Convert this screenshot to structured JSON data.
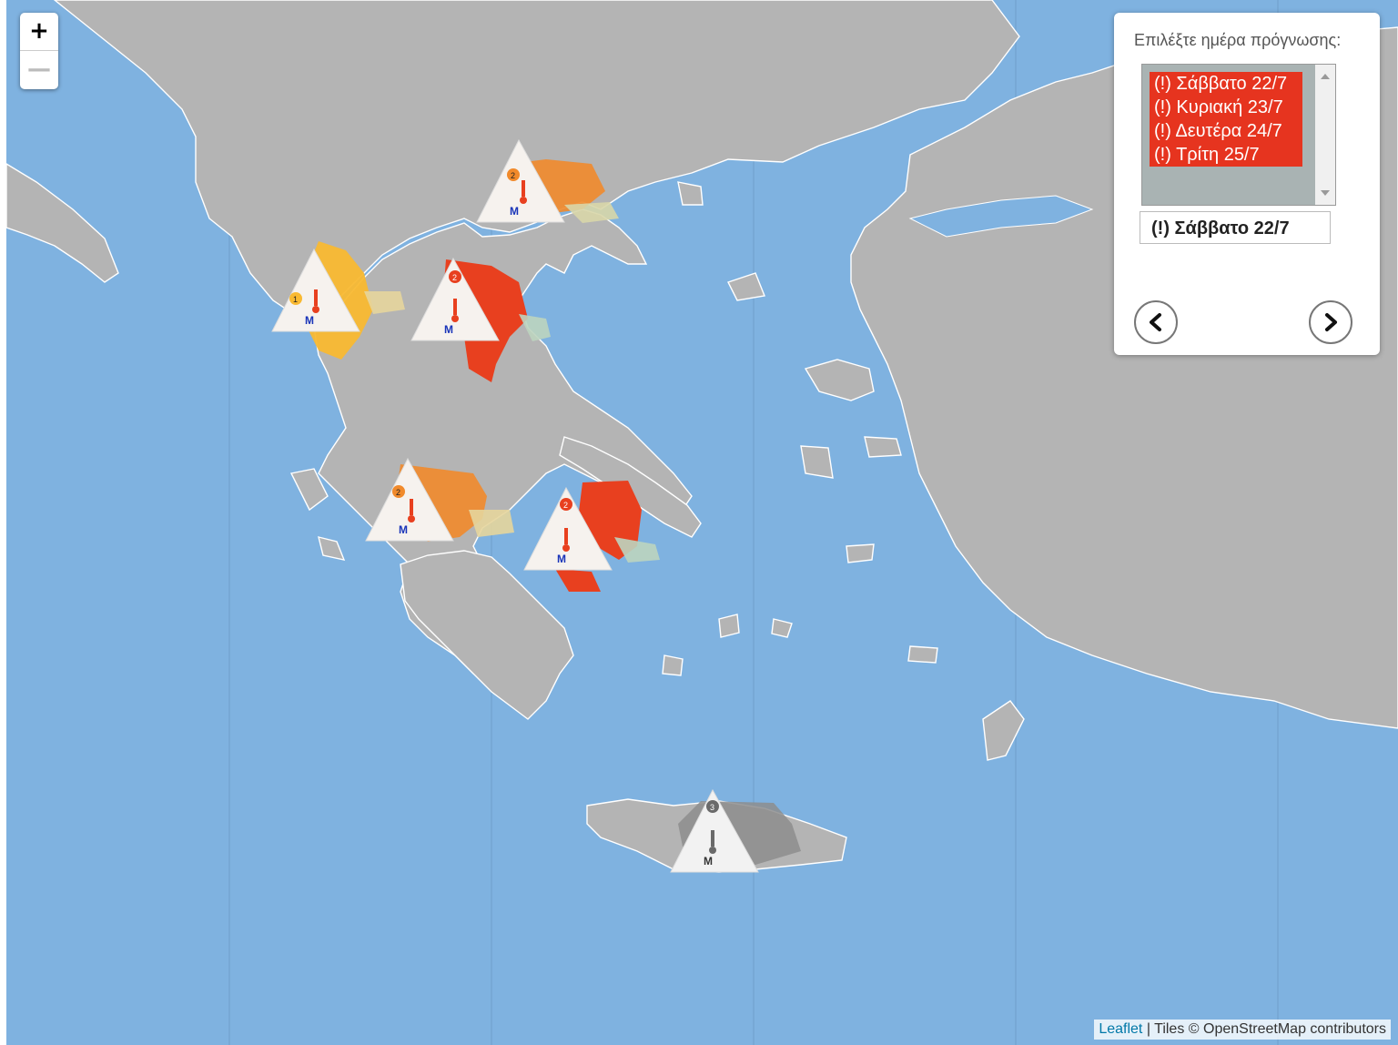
{
  "map": {
    "zoom": {
      "in_label": "+",
      "out_label": "—"
    },
    "attribution": {
      "leaflet": "Leaflet",
      "separator": " | ",
      "tiles": "Tiles © OpenStreetMap contributors"
    },
    "colors": {
      "sea": "#7fb2e0",
      "land": "#b3b3b3",
      "border": "#ffffff",
      "level2": "#e8401f",
      "level1": "#f9b931",
      "level1_orange": "#f18a2b",
      "grey": "#8d8d8d"
    }
  },
  "forecast_panel": {
    "label": "Επιλέξτε ημέρα πρόγνωσης:",
    "options": [
      "(!) Σάββατο 22/7",
      "(!) Κυριακή 23/7",
      "(!) Δευτέρα 24/7",
      "(!) Τρίτη 25/7"
    ],
    "selected": "(!) Σάββατο 22/7",
    "prev_icon": "chevron-left-icon",
    "next_icon": "chevron-right-icon"
  },
  "warning_markers": [
    {
      "region": "central-macedonia",
      "level": "2",
      "color": "orange"
    },
    {
      "region": "epirus",
      "level": "1",
      "color": "yellow"
    },
    {
      "region": "thessaly",
      "level": "2",
      "color": "red"
    },
    {
      "region": "western-greece",
      "level": "2",
      "color": "orange"
    },
    {
      "region": "attica",
      "level": "2",
      "color": "red"
    },
    {
      "region": "crete",
      "level": "3",
      "color": "grey"
    }
  ]
}
